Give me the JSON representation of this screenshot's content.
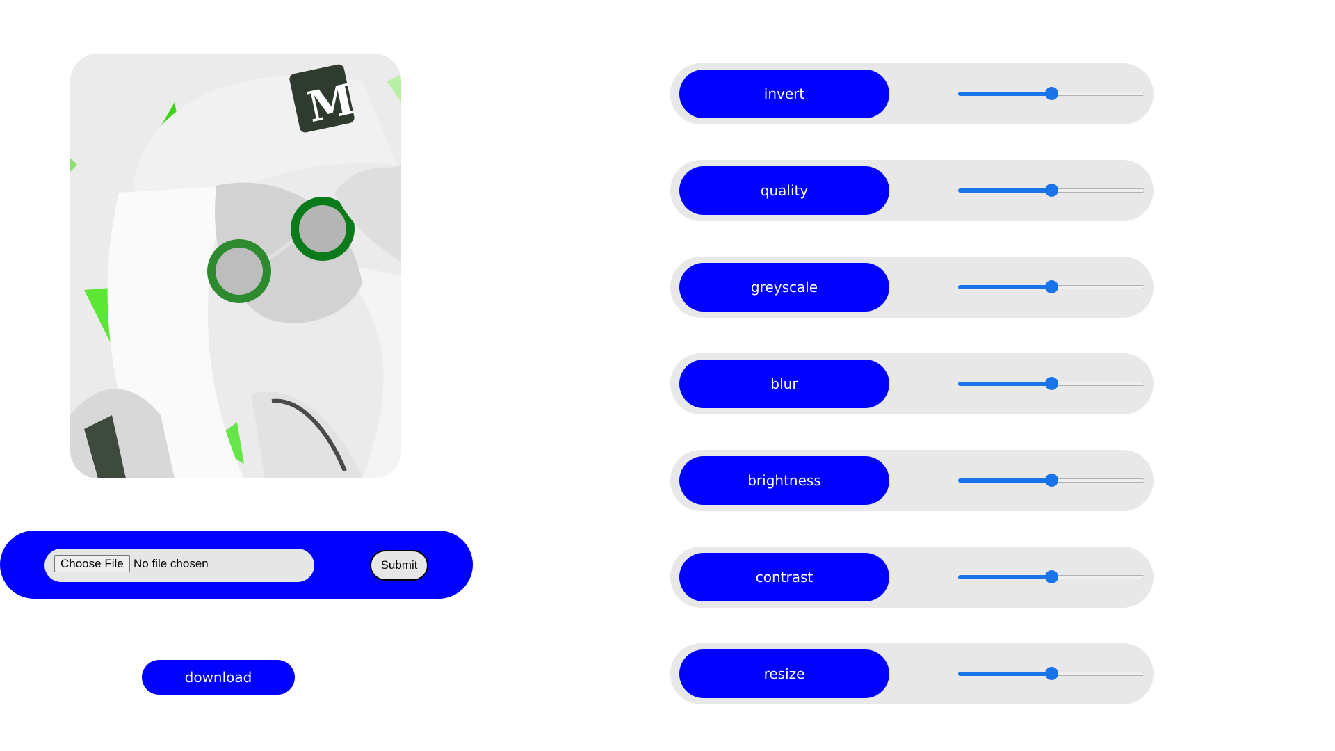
{
  "preview": {
    "alt": "inverted character illustration",
    "accent": "#33dd11"
  },
  "upload": {
    "choose_label": "Choose File",
    "no_file_label": "No file chosen",
    "submit_label": "Submit"
  },
  "download_label": "download",
  "controls": [
    {
      "label": "invert",
      "value": 0.5
    },
    {
      "label": "quality",
      "value": 0.5
    },
    {
      "label": "greyscale",
      "value": 0.5
    },
    {
      "label": "blur",
      "value": 0.5
    },
    {
      "label": "brightness",
      "value": 0.5
    },
    {
      "label": "contrast",
      "value": 0.5
    },
    {
      "label": "resize",
      "value": 0.5
    }
  ],
  "colors": {
    "primary": "#0000ff",
    "panel": "#e8e8e8",
    "slider": "#1a73e8"
  }
}
